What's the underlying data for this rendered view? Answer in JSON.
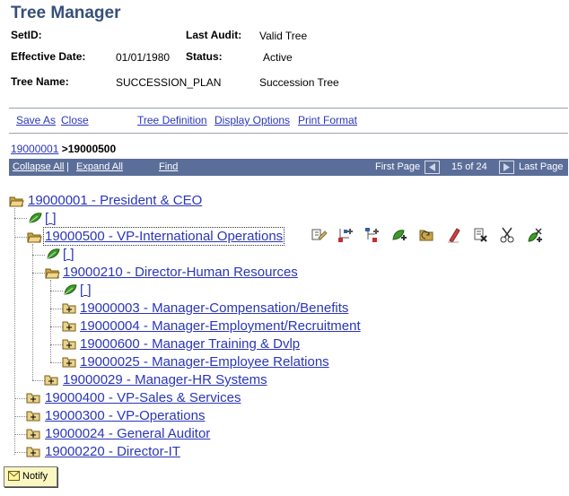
{
  "page": {
    "title": "Tree Manager"
  },
  "header": {
    "setid_label": "SetID:",
    "last_audit_label": "Last Audit:",
    "last_audit_value": "Valid Tree",
    "effective_date_label": "Effective Date:",
    "effective_date_value": "01/01/1980",
    "status_label": "Status:",
    "status_value": "Active",
    "tree_name_label": "Tree Name:",
    "tree_name_value": "SUCCESSION_PLAN",
    "tree_desc": "Succession Tree"
  },
  "actions": {
    "save_as": "Save As",
    "close": "Close",
    "tree_definition": "Tree Definition",
    "display_options": "Display Options",
    "print_format": "Print Format"
  },
  "breadcrumb": {
    "parent": "19000001",
    "separator": ">",
    "current": "19000500"
  },
  "toolbar": {
    "collapse_all": "Collapse All",
    "divider": "|",
    "expand_all": "Expand All",
    "find": "Find",
    "first_page": "First Page",
    "page_info": "15 of 24",
    "last_page": "Last Page"
  },
  "tree": {
    "root": "19000001 - President & CEO",
    "root_leaf": "[ ]",
    "n500": "19000500 - VP-International Operations",
    "n500_leaf": "[ ]",
    "n210": "19000210 - Director-Human Resources",
    "n210_leaf": "[ ]",
    "n003": "19000003 - Manager-Compensation/Benefits",
    "n004": "19000004 - Manager-Employment/Recruitment",
    "n600": "19000600 - Manager Training & Dvlp",
    "n025": "19000025 - Manager-Employee Relations",
    "n029": "19000029 - Manager-HR Systems",
    "n400": "19000400 - VP-Sales & Services",
    "n300": "19000300 - VP-Operations",
    "n024": "19000024 - General Auditor",
    "n220": "19000220 - Director-IT"
  },
  "node_toolbar": [
    "edit-data-icon",
    "insert-sibling-icon",
    "insert-child-icon",
    "insert-detail-icon",
    "move-node-icon",
    "edit-detail-icon",
    "delete-icon",
    "cut-icon",
    "paste-icon"
  ],
  "footer": {
    "notify": "Notify"
  },
  "colors": {
    "title": "#36507a",
    "link": "#2a36b8",
    "bar": "#5b6e99",
    "folder": "#c9a64a",
    "leaf": "#3d9a2a"
  }
}
